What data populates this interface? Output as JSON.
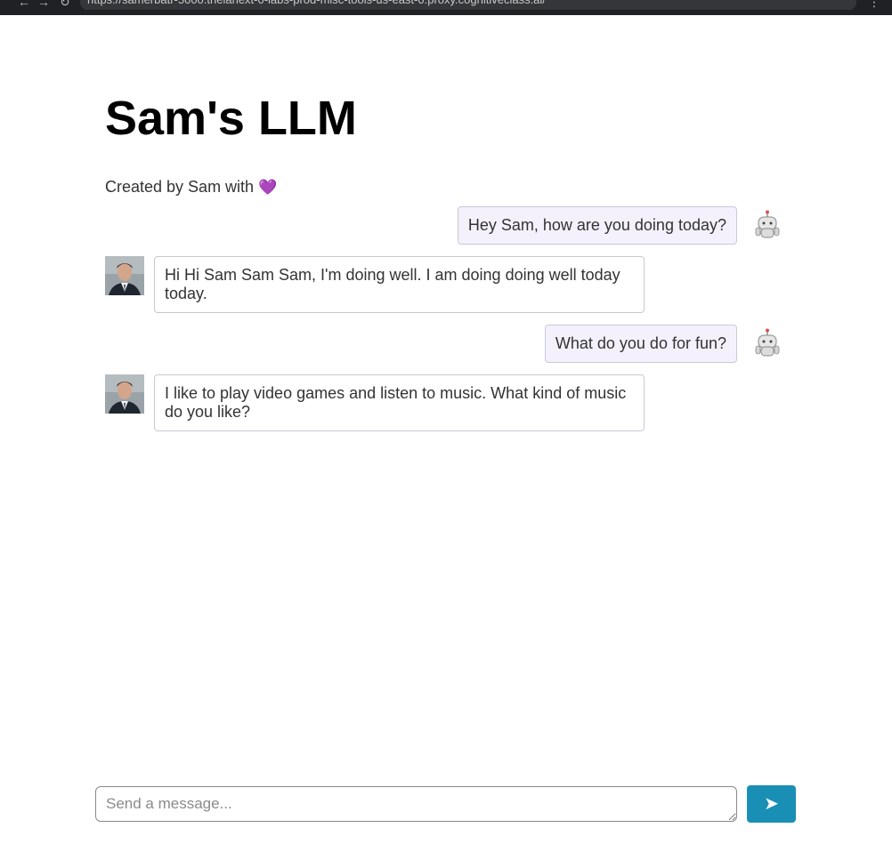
{
  "browser": {
    "url": "https://samerbatr-5000.theianext-0-labs-prod-misc-tools-us-east-0.proxy.cognitiveclass.ai/"
  },
  "page": {
    "title": "Sam's LLM",
    "subtitle": "Created by Sam with",
    "heart": "💜"
  },
  "messages": [
    {
      "role": "user",
      "text": "Hey Sam, how are you doing today?"
    },
    {
      "role": "bot",
      "text": "Hi Hi Sam Sam Sam, I'm doing well. I am doing doing well today today."
    },
    {
      "role": "user",
      "text": "What do you do for fun?"
    },
    {
      "role": "bot",
      "text": "I like to play video games and listen to music. What kind of music do you like?"
    }
  ],
  "composer": {
    "placeholder": "Send a message...",
    "send_label": "➤"
  },
  "colors": {
    "accent": "#1a8fb6",
    "user_bubble": "#f4f1fd",
    "heart": "#7b4fe0"
  }
}
